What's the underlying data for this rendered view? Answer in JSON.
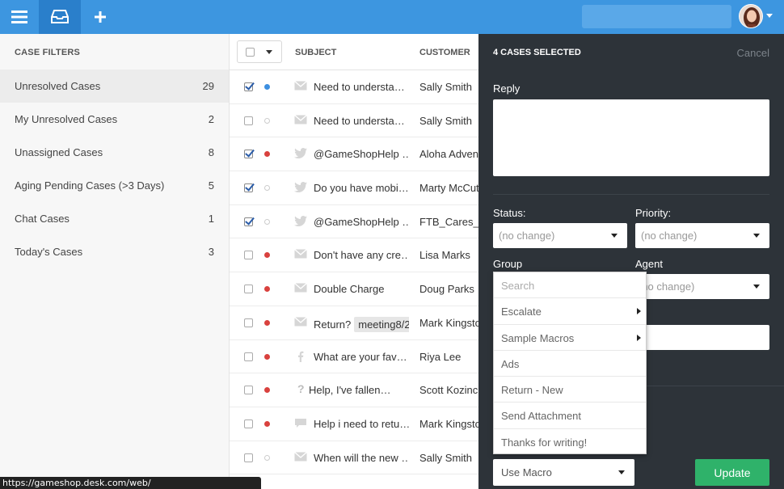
{
  "topbar": {
    "menu_icon": "hamburger-icon",
    "inbox_icon": "inbox-tray-icon",
    "add_icon": "plus-icon",
    "accent": "#3d96e0"
  },
  "sidebar": {
    "title": "CASE FILTERS",
    "items": [
      {
        "label": "Unresolved Cases",
        "count": "29"
      },
      {
        "label": "My Unresolved Cases",
        "count": "2"
      },
      {
        "label": "Unassigned Cases",
        "count": "8"
      },
      {
        "label": "Aging Pending Cases (>3 Days)",
        "count": "5"
      },
      {
        "label": "Chat Cases",
        "count": "1"
      },
      {
        "label": "Today's Cases",
        "count": "3"
      }
    ]
  },
  "list": {
    "columns": {
      "subject": "SUBJECT",
      "customer": "CUSTOMER"
    },
    "rows": [
      {
        "checked": true,
        "status": "blue",
        "channel": "email-icon",
        "subject": "Need to understa…",
        "tag": "",
        "customer": "Sally Smith"
      },
      {
        "checked": false,
        "status": "empty",
        "channel": "email-icon",
        "subject": "Need to understa…",
        "tag": "",
        "customer": "Sally Smith"
      },
      {
        "checked": true,
        "status": "red",
        "channel": "twitter-icon",
        "subject": "@GameShopHelp …",
        "tag": "",
        "customer": "Aloha Advent"
      },
      {
        "checked": true,
        "status": "empty",
        "channel": "twitter-icon",
        "subject": "Do you have mobi…",
        "tag": "",
        "customer": "Marty McCut"
      },
      {
        "checked": true,
        "status": "empty",
        "channel": "twitter-icon",
        "subject": "@GameShopHelp …",
        "tag": "",
        "customer": "FTB_Cares_B"
      },
      {
        "checked": false,
        "status": "red",
        "channel": "email-icon",
        "subject": "Don't have any cre…",
        "tag": "",
        "customer": "Lisa Marks"
      },
      {
        "checked": false,
        "status": "red",
        "channel": "email-icon",
        "subject": "Double Charge",
        "tag": "",
        "customer": "Doug Parks"
      },
      {
        "checked": false,
        "status": "red",
        "channel": "email-icon",
        "subject": "Return?",
        "tag": "meeting8/2",
        "customer": "Mark Kingsto"
      },
      {
        "checked": false,
        "status": "red",
        "channel": "facebook-icon",
        "subject": "What are your fav…",
        "tag": "",
        "customer": "Riya Lee"
      },
      {
        "checked": false,
        "status": "red",
        "channel": "question-icon",
        "subject": "Help, I've fallen…",
        "tag": "",
        "customer": "Scott Kozinch"
      },
      {
        "checked": false,
        "status": "red",
        "channel": "chat-icon",
        "subject": "Help i need to retu…",
        "tag": "",
        "customer": "Mark Kingsto"
      },
      {
        "checked": false,
        "status": "empty",
        "channel": "email-icon",
        "subject": "When will the new …",
        "tag": "",
        "customer": "Sally Smith"
      }
    ]
  },
  "panel": {
    "header": "4 CASES SELECTED",
    "cancel": "Cancel",
    "reply_label": "Reply",
    "status_label": "Status:",
    "status_value": "(no change)",
    "priority_label": "Priority:",
    "priority_value": "(no change)",
    "group_label": "Group",
    "agent_label": "Agent",
    "agent_value": "(no change)",
    "macro_menu": {
      "search_placeholder": "Search",
      "items": [
        {
          "label": "Escalate",
          "submenu": true
        },
        {
          "label": "Sample Macros",
          "submenu": true
        },
        {
          "label": "Ads",
          "submenu": false
        },
        {
          "label": "Return - New",
          "submenu": false
        },
        {
          "label": "Send Attachment",
          "submenu": false
        },
        {
          "label": "Thanks for writing!",
          "submenu": false
        }
      ]
    },
    "use_macro": "Use Macro",
    "update": "Update"
  },
  "statusbar": {
    "url": "https://gameshop.desk.com/web/"
  }
}
